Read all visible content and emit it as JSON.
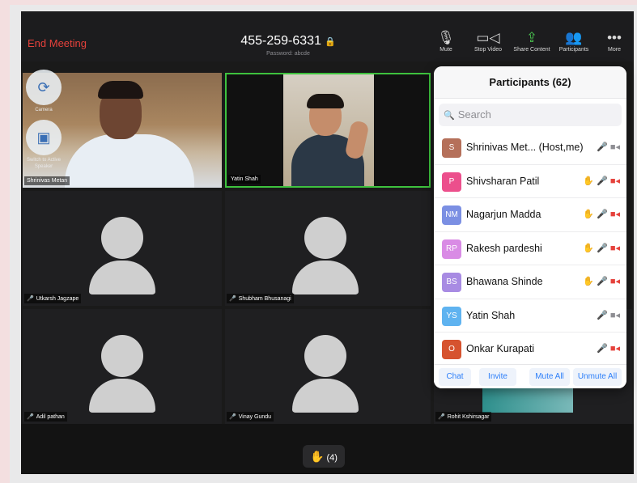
{
  "meeting": {
    "end_label": "End Meeting",
    "id": "455-259-6331",
    "password": "Password: abcde"
  },
  "toolbar": [
    {
      "label": "Mute",
      "icon": "microphone-icon",
      "glyph": "🎙"
    },
    {
      "label": "Stop Video",
      "icon": "video-camera-icon",
      "glyph": "📹"
    },
    {
      "label": "Share Content",
      "icon": "share-icon",
      "glyph": "⇪"
    },
    {
      "label": "Participants",
      "icon": "participants-icon",
      "glyph": "👥"
    },
    {
      "label": "More",
      "icon": "more-icon",
      "glyph": "•••"
    }
  ],
  "camera_controls": {
    "switch_camera_label": "Camera",
    "switch_speaker_label": "Switch to Active Speaker"
  },
  "videos": [
    {
      "name": "Shrinivas Metan"
    },
    {
      "name": "Yatin Shah"
    },
    {
      "name": "Utkarsh Jagzape"
    },
    {
      "name": "Shubham Bhusanagi"
    },
    {
      "name": "Adil pathan"
    },
    {
      "name": "Vinay Gundu"
    },
    {
      "name": "Rohit Kshirsagar"
    }
  ],
  "raise_hands": {
    "count": "(4)"
  },
  "participants_panel": {
    "title": "Participants (62)",
    "search_placeholder": "Search",
    "participants": [
      {
        "initials": "S",
        "name": "Shrinivas Met...  (Host,me)",
        "color": "#b5705a",
        "hand": false,
        "mic": "unmuted",
        "video": "on"
      },
      {
        "initials": "P",
        "name": "Shivsharan Patil",
        "color": "#ec4f8c",
        "hand": true,
        "mic": "unmuted",
        "video": "off"
      },
      {
        "initials": "NM",
        "name": "Nagarjun Madda",
        "color": "#7b8fe3",
        "hand": true,
        "mic": "muted",
        "video": "off"
      },
      {
        "initials": "RP",
        "name": "Rakesh pardeshi",
        "color": "#d98be5",
        "hand": true,
        "mic": "muted",
        "video": "off"
      },
      {
        "initials": "BS",
        "name": "Bhawana Shinde",
        "color": "#a88be3",
        "hand": true,
        "mic": "muted",
        "video": "off"
      },
      {
        "initials": "YS",
        "name": "Yatin Shah",
        "color": "#5fb3f0",
        "hand": false,
        "mic": "speaking",
        "video": "on"
      },
      {
        "initials": "O",
        "name": "Onkar Kurapati",
        "color": "#d6532f",
        "hand": false,
        "mic": "unmuted",
        "video": "off"
      }
    ],
    "footer": {
      "chat": "Chat",
      "invite": "Invite",
      "mute_all": "Mute All",
      "unmute_all": "Unmute All"
    }
  }
}
